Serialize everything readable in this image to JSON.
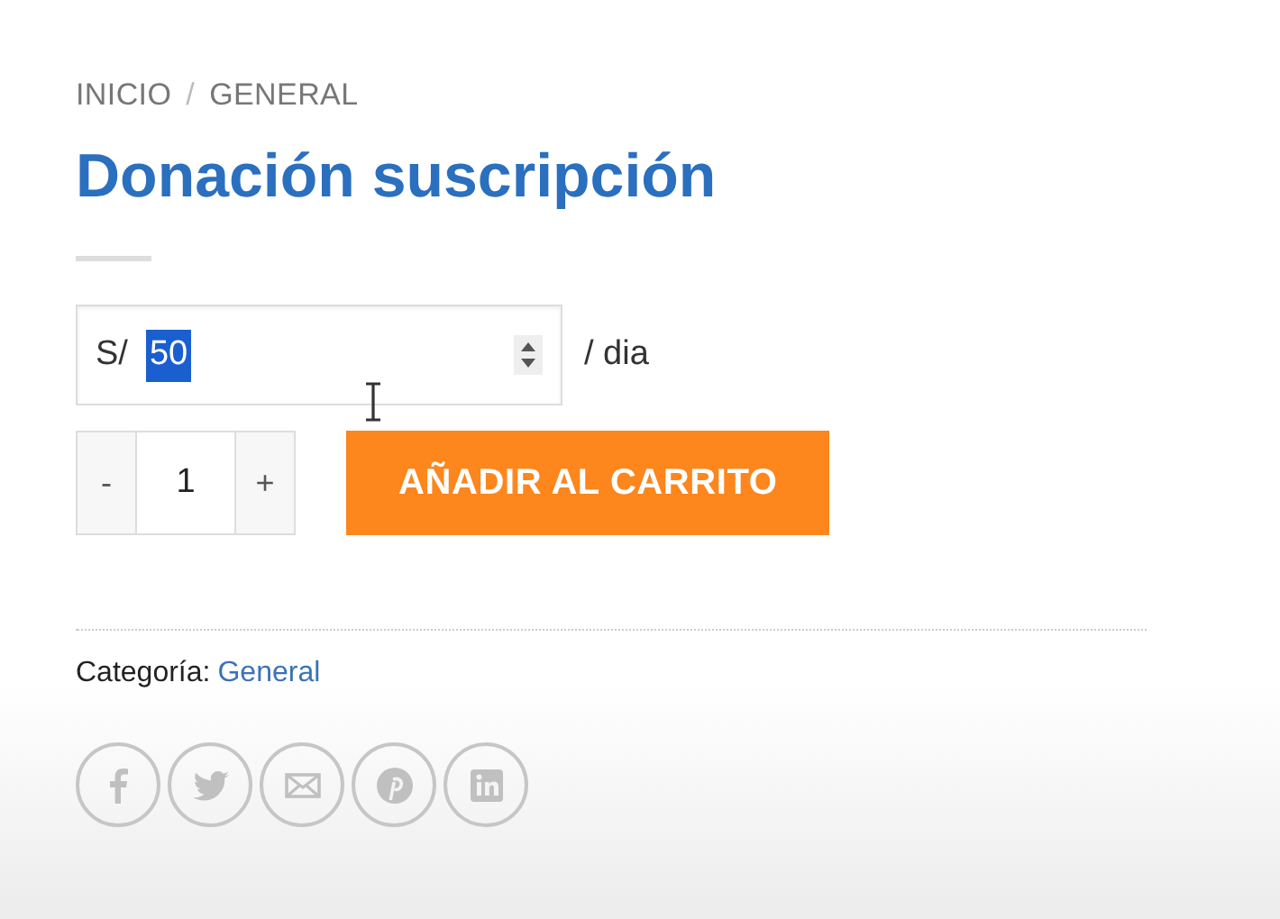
{
  "breadcrumb": [
    "INICIO",
    "GENERAL"
  ],
  "breadcrumb_separator": "/",
  "title": "Donación suscripción",
  "price_field": {
    "prefix": "S/",
    "value": "50",
    "value_highlighted": true,
    "suffix": "/ dia"
  },
  "quantity": {
    "minus": "-",
    "value": "1",
    "plus": "+"
  },
  "add_button": "AÑADIR AL CARRITO",
  "category": {
    "label": "Categoría:",
    "link": "General"
  },
  "share": [
    {
      "kind": "facebook"
    },
    {
      "kind": "twitter"
    },
    {
      "kind": "email"
    },
    {
      "kind": "pinterest"
    },
    {
      "kind": "linkedin"
    }
  ]
}
